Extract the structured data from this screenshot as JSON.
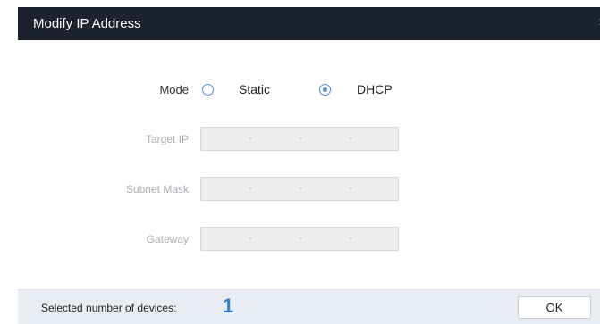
{
  "dialog": {
    "title": "Modify IP Address",
    "close_glyph": "×"
  },
  "form": {
    "mode_label": "Mode",
    "mode_options": [
      {
        "label": "Static",
        "selected": false
      },
      {
        "label": "DHCP",
        "selected": true
      }
    ],
    "fields": [
      {
        "label": "Target IP",
        "value": "",
        "disabled": true
      },
      {
        "label": "Subnet Mask",
        "value": "",
        "disabled": true
      },
      {
        "label": "Gateway",
        "value": "",
        "disabled": true
      }
    ],
    "ip_separator": "."
  },
  "footer": {
    "selected_label": "Selected number of devices:",
    "selected_count": "1",
    "ok_label": "OK"
  },
  "colors": {
    "titlebar": "#1c2230",
    "accent": "#2f80d4",
    "footer_bg": "#e9edf3"
  }
}
